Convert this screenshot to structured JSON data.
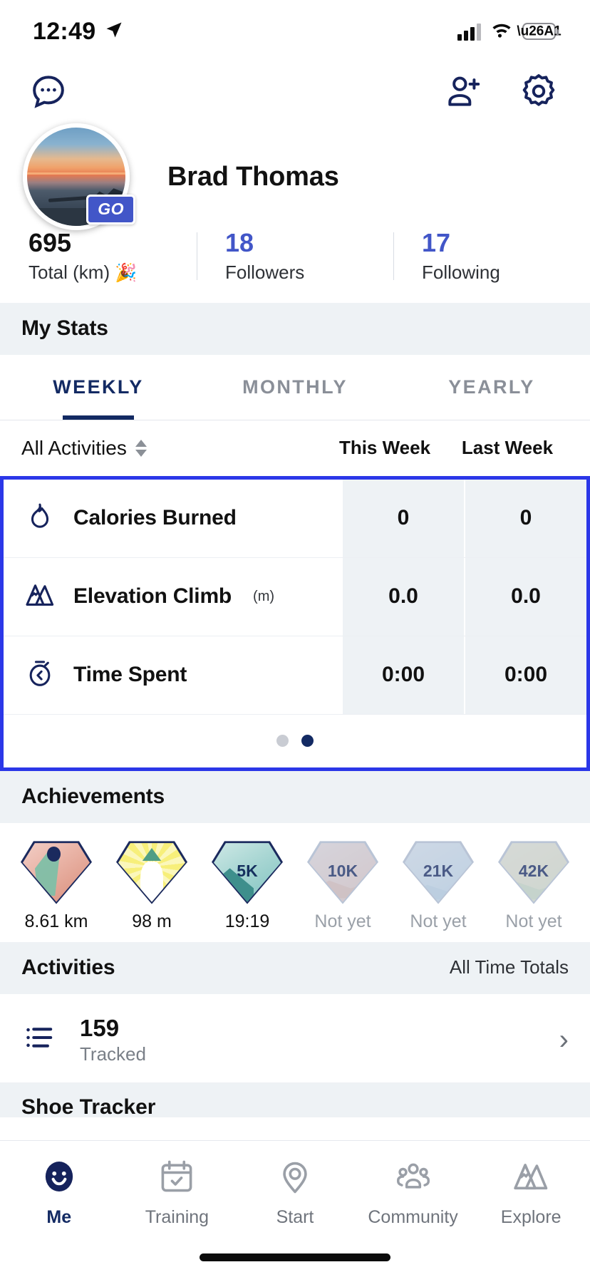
{
  "status_bar": {
    "time": "12:49",
    "location_icon": "location-arrow-icon",
    "signal_icon": "cellular-signal-icon",
    "wifi_icon": "wifi-icon",
    "battery_icon": "battery-charging-icon"
  },
  "app_nav": {
    "messages_label": "messages-icon",
    "add_friend_label": "add-friend-icon",
    "settings_label": "settings-icon"
  },
  "profile": {
    "name": "Brad Thomas",
    "go_badge": "GO",
    "counts": [
      {
        "value": "695",
        "label": "Total (km)",
        "emoji": "🎉",
        "accent": false
      },
      {
        "value": "18",
        "label": "Followers",
        "emoji": "",
        "accent": true
      },
      {
        "value": "17",
        "label": "Following",
        "emoji": "",
        "accent": true
      }
    ]
  },
  "my_stats": {
    "title": "My Stats",
    "tabs": [
      {
        "label": "WEEKLY",
        "active": true
      },
      {
        "label": "MONTHLY",
        "active": false
      },
      {
        "label": "YEARLY",
        "active": false
      }
    ],
    "filter_label": "All Activities",
    "columns": [
      "This Week",
      "Last Week"
    ],
    "rows": [
      {
        "icon": "flame-icon",
        "label": "Calories Burned",
        "unit": "",
        "this_week": "0",
        "last_week": "0"
      },
      {
        "icon": "mountain-icon",
        "label": "Elevation Climb",
        "unit": "(m)",
        "this_week": "0.0",
        "last_week": "0.0"
      },
      {
        "icon": "stopwatch-icon",
        "label": "Time Spent",
        "unit": "",
        "this_week": "0:00",
        "last_week": "0:00"
      }
    ],
    "pager": {
      "count": 2,
      "active_index": 1
    },
    "highlight_color": "#2b37e8"
  },
  "achievements": {
    "title": "Achievements",
    "items": [
      {
        "badge": "",
        "caption": "8.61 km",
        "earned": true
      },
      {
        "badge": "",
        "caption": "98 m",
        "earned": true
      },
      {
        "badge": "5K",
        "caption": "19:19",
        "earned": true
      },
      {
        "badge": "10K",
        "caption": "Not yet",
        "earned": false
      },
      {
        "badge": "21K",
        "caption": "Not yet",
        "earned": false
      },
      {
        "badge": "42K",
        "caption": "Not yet",
        "earned": false
      }
    ]
  },
  "activities": {
    "title": "Activities",
    "subtitle": "All Time Totals",
    "rows": [
      {
        "icon": "list-icon",
        "value": "159",
        "label": "Tracked",
        "chevron": "›"
      }
    ]
  },
  "shoe_tracker": {
    "title": "Shoe Tracker"
  },
  "tabbar": {
    "items": [
      {
        "label": "Me",
        "icon": "smiley-face-icon",
        "active": true
      },
      {
        "label": "Training",
        "icon": "calendar-check-icon",
        "active": false
      },
      {
        "label": "Start",
        "icon": "location-pin-icon",
        "active": false
      },
      {
        "label": "Community",
        "icon": "people-group-icon",
        "active": false
      },
      {
        "label": "Explore",
        "icon": "mountains-icon",
        "active": false
      }
    ]
  }
}
